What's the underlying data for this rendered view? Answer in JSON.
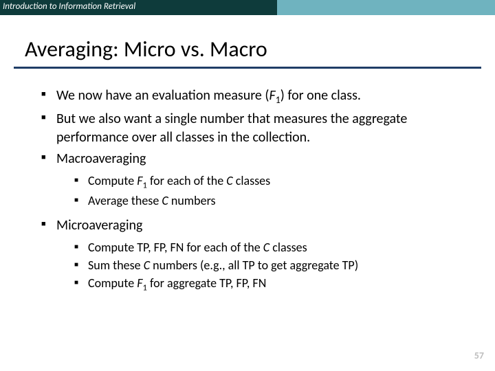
{
  "header": {
    "course": "Introduction to Information Retrieval"
  },
  "title": "Averaging: Micro vs. Macro",
  "bullets": {
    "b1a": "We now have an evaluation measure (",
    "b1b": ") for one class.",
    "b2": "But we also want a single number that measures the aggregate performance over all classes in the collection.",
    "b3": "Macroaveraging",
    "b3_1a": "Compute ",
    "b3_1b": " for each of the ",
    "b3_1c": " classes",
    "b3_2a": "Average these ",
    "b3_2b": " numbers",
    "b4": "Microaveraging",
    "b4_1a": "Compute TP, FP, FN for each of the ",
    "b4_1b": " classes",
    "b4_2a": "Sum these ",
    "b4_2b": " numbers (e.g., all TP to get aggregate TP)",
    "b4_3a": "Compute ",
    "b4_3b": " for aggregate TP, FP, FN"
  },
  "sym": {
    "F": "F",
    "one": "1",
    "C": "C"
  },
  "page": "57"
}
